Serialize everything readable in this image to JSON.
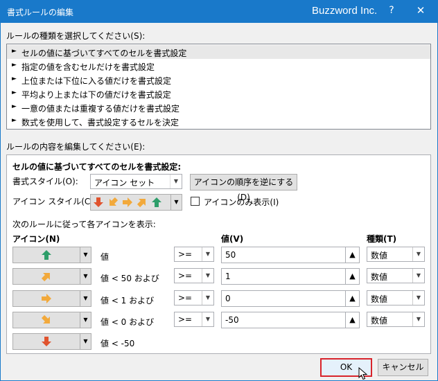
{
  "window": {
    "title": "書式ルールの編集",
    "brand": "Buzzword Inc.",
    "help": "?",
    "close": "✕"
  },
  "rule_type": {
    "label": "ルールの種類を選択してください(S):",
    "items": [
      {
        "label": "セルの値に基づいてすべてのセルを書式設定",
        "selected": true
      },
      {
        "label": "指定の値を含むセルだけを書式設定"
      },
      {
        "label": "上位または下位に入る値だけを書式設定"
      },
      {
        "label": "平均より上または下の値だけを書式設定"
      },
      {
        "label": "一意の値または重複する値だけを書式設定"
      },
      {
        "label": "数式を使用して、書式設定するセルを決定"
      }
    ]
  },
  "edit": {
    "label": "ルールの内容を編集してください(E):",
    "heading": "セルの値に基づいてすべてのセルを書式設定:",
    "format_style_label": "書式スタイル(O):",
    "format_style_value": "アイコン セット",
    "reverse_button": "アイコンの順序を逆にする(D)",
    "icon_style_label": "アイコン スタイル(C):",
    "icon_only_label": "アイコンのみ表示(I)",
    "rules_caption": "次のルールに従って各アイコンを表示:",
    "col_icon": "アイコン(N)",
    "col_value": "値(V)",
    "col_type": "種類(T)",
    "rows": [
      {
        "icon": "arrow-up-green",
        "desc": "値",
        "op": ">=",
        "value": "50",
        "type": "数値"
      },
      {
        "icon": "arrow-upright-yellow",
        "desc": "値 < 50 および",
        "op": ">=",
        "value": "1",
        "type": "数値"
      },
      {
        "icon": "arrow-right-yellow",
        "desc": "値 < 1 および",
        "op": ">=",
        "value": "0",
        "type": "数値"
      },
      {
        "icon": "arrow-downright-yellow",
        "desc": "値 < 0 および",
        "op": ">=",
        "value": "-50",
        "type": "数値"
      },
      {
        "icon": "arrow-down-red",
        "desc": "値 < -50"
      }
    ]
  },
  "buttons": {
    "ok": "OK",
    "cancel": "キャンセル"
  },
  "colors": {
    "titlebar": "#1979ca",
    "arrow_red": "#e0532e",
    "arrow_yellow": "#f2a93b",
    "arrow_green": "#2e9e6a",
    "ok_highlight": "#d8232a"
  }
}
